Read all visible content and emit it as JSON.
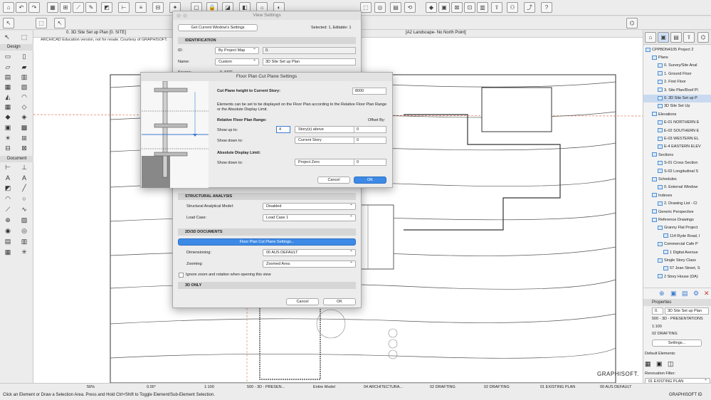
{
  "tab": {
    "label": "0. 3D Site Set up Plan [0. SITE]"
  },
  "layout_label": "[A2 Landscape- No North Point]",
  "edu_notice": "ARCHICAD Education version, not for resale. Courtesy of GRAPHISOFT.",
  "left_panel": {
    "design_header": "Design",
    "document_header": "Document"
  },
  "navigator": {
    "project": "CPPBDN4105 Project 2",
    "items": [
      {
        "label": "Plans"
      },
      {
        "label": "0. Survey/Site Anal"
      },
      {
        "label": "1. Ground Floor"
      },
      {
        "label": "2. First Floor"
      },
      {
        "label": "3. Site Plan/Roof Pl"
      },
      {
        "label": "0. 3D Site Set up P"
      },
      {
        "label": "3D Site Set Up"
      },
      {
        "label": "Elevations"
      },
      {
        "label": "E-01 NORTHERN E"
      },
      {
        "label": "E-02 SOUTHERN E"
      },
      {
        "label": "E-03 WESTERN EL"
      },
      {
        "label": "E-4 EASTERN ELEV"
      },
      {
        "label": "Sections"
      },
      {
        "label": "S-01 Cross Section"
      },
      {
        "label": "S-02 Longitudinal S"
      },
      {
        "label": "Schedules"
      },
      {
        "label": "0. External Window"
      },
      {
        "label": "Indexes"
      },
      {
        "label": "2. Drawing List - Cl"
      },
      {
        "label": "Generic Perspective"
      },
      {
        "label": "Reference Drawings"
      },
      {
        "label": "Granny Flat Project"
      },
      {
        "label": "114 Ryde Road, I"
      },
      {
        "label": "Commercial Cafe P"
      },
      {
        "label": "1 Digital Avenue"
      },
      {
        "label": "Single Story Class"
      },
      {
        "label": "57 Jean Street, S"
      },
      {
        "label": "2 Story House (DA)"
      }
    ]
  },
  "properties": {
    "header": "Properties",
    "id": "0.",
    "name": "3D Site Set up Plan",
    "layer": "500 - 3D - PRESENTATIONS",
    "scale": "1:100",
    "pen_set": "02 DRAFTING",
    "settings_button": "Settings...",
    "default_elements": "Default Elements:",
    "renovation_filter": "Renovation Filter:",
    "renovation_value": "01 EXISTING PLAN"
  },
  "status_bar": {
    "zoom": "56%",
    "angle": "0.00°",
    "scale": "1:100",
    "layer_combo": "500 - 3D - PRESEN...",
    "model": "Entire Model",
    "pen_set": "04 ARCHITECTURA...",
    "mvo": "02 DRAFTING",
    "dim": "02 DRAFTING",
    "renovation": "01 EXISTING PLAN",
    "dimension": "00 AUS DEFAULT"
  },
  "footer": {
    "hint": "Click an Element or Draw a Selection Area. Press and Hold Ctrl+Shift to Toggle Element/Sub-Element Selection.",
    "brand": "GRAPHISOFT ID",
    "watermark": "GRAPHISOFT."
  },
  "view_settings": {
    "title": "View Settings",
    "get_current": "Get Current Window's Settings",
    "selected_info": "Selected: 1, Editable: 1",
    "identification": "IDENTIFICATION",
    "id_label": "ID:",
    "id_mode": "By Project Map",
    "id_value": "0.",
    "name_label": "Name:",
    "name_mode": "Custom",
    "name_value": "3D Site Set up Plan",
    "source_label": "Source:",
    "source_value": "0. SITE",
    "structural_header": "STRUCTURAL ANALYSIS",
    "sam_label": "Structural Analytical Model:",
    "sam_value": "Disabled",
    "load_case_label": "Load Case:",
    "load_case_value": "Load Case 1",
    "docs_header": "2D/3D DOCUMENTS",
    "fpcp_button": "Floor Plan Cut Plane Settings...",
    "dimensioning_label": "Dimensioning:",
    "dimensioning_value": "00 AUS DEFAULT",
    "zooming_label": "Zooming:",
    "zooming_value": "Zoomed Area",
    "ignore_zoom": "Ignore zoom and rotation when opening this view",
    "threed_header": "3D ONLY",
    "cancel": "Cancel",
    "ok": "OK"
  },
  "cut_plane": {
    "title": "Floor Plan Cut Plane Settings",
    "height_label": "Cut Plane height to Current Story:",
    "height_value": "8000",
    "description": "Elements can be set to be displayed on the Floor Plan according to the Relative Floor Plan Range or the Absolute Display Limit.",
    "relative_header": "Relative Floor Plan Range:",
    "offset_by": "Offset By:",
    "show_up_label": "Show up to:",
    "show_up_count": "4",
    "show_up_mode": "Story(s) above",
    "show_up_offset": "0",
    "show_down_label": "Show down to:",
    "show_down_mode": "Current Story",
    "show_down_offset": "0",
    "absolute_header": "Absolute Display Limit:",
    "abs_down_label": "Show down to:",
    "abs_down_mode": "Project Zero",
    "abs_down_offset": "0",
    "cancel": "Cancel",
    "ok": "OK"
  },
  "colors": {
    "accent": "#3d8ae6",
    "dialog_bg": "#ececec",
    "selection": "#c9daf0"
  }
}
